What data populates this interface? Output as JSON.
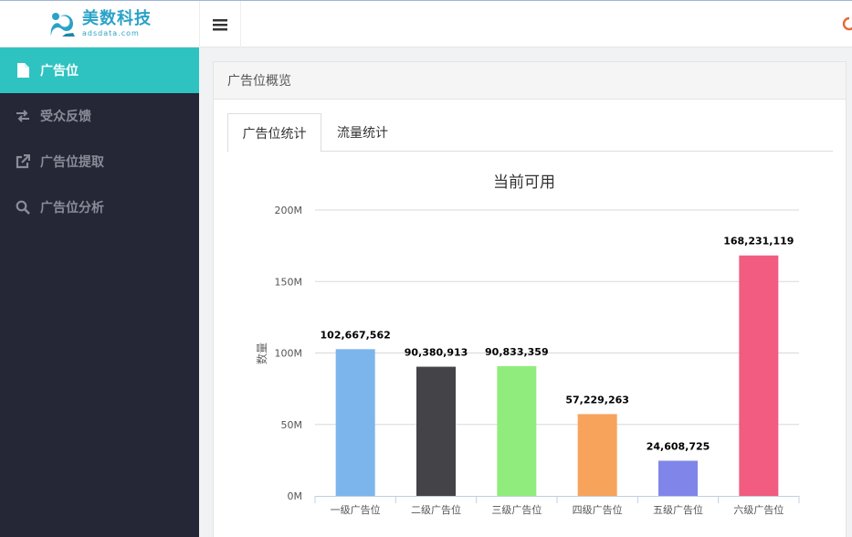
{
  "logo": {
    "name": "美数科技",
    "domain": "adsdata.com"
  },
  "sidebar": {
    "items": [
      {
        "label": "广告位",
        "icon": "file-icon",
        "active": true
      },
      {
        "label": "受众反馈",
        "icon": "exchange-icon",
        "active": false
      },
      {
        "label": "广告位提取",
        "icon": "external-link-icon",
        "active": false
      },
      {
        "label": "广告位分析",
        "icon": "search-icon",
        "active": false
      }
    ]
  },
  "panel": {
    "title": "广告位概览",
    "tabs": [
      {
        "label": "广告位统计",
        "active": true
      },
      {
        "label": "流量统计",
        "active": false
      }
    ]
  },
  "chart_data": {
    "type": "bar",
    "title": "当前可用",
    "ylabel": "数量",
    "xlabel": "",
    "categories": [
      "一级广告位",
      "二级广告位",
      "三级广告位",
      "四级广告位",
      "五级广告位",
      "六级广告位"
    ],
    "values": [
      102667562,
      90380913,
      90833359,
      57229263,
      24608725,
      168231119
    ],
    "data_labels": [
      "102,667,562",
      "90,380,913",
      "90,833,359",
      "57,229,263",
      "24,608,725",
      "168,231,119"
    ],
    "colors": [
      "#7cb5ec",
      "#434348",
      "#90ed7d",
      "#f7a35c",
      "#8085e9",
      "#f15c80"
    ],
    "ylim": [
      0,
      200000000
    ],
    "yticks": [
      "0M",
      "50M",
      "100M",
      "150M",
      "200M"
    ],
    "grid": true
  }
}
